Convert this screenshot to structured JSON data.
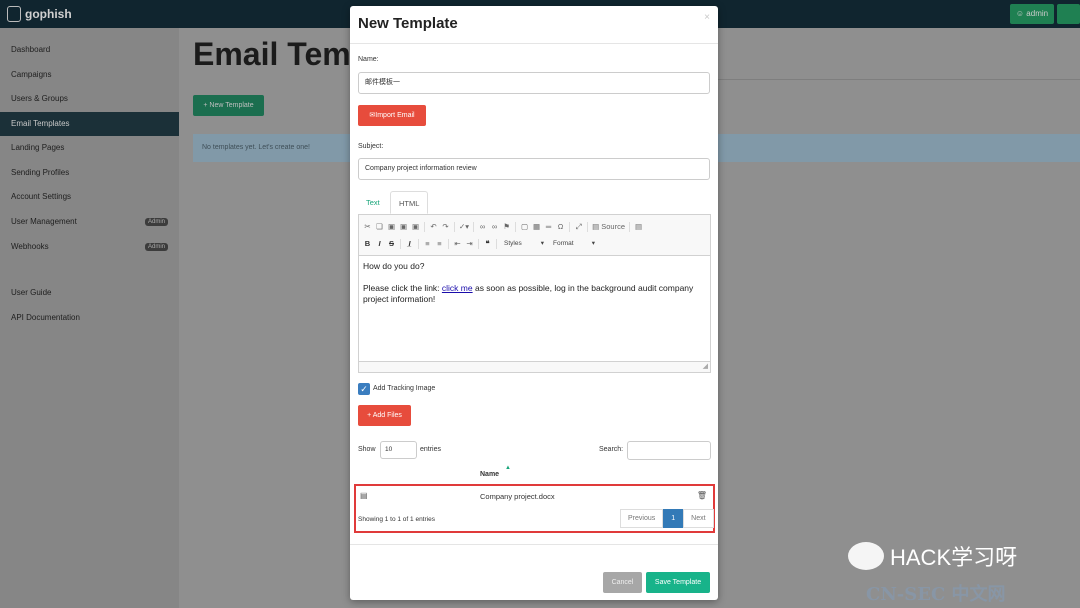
{
  "app": {
    "logo": "gophish",
    "user_button": "admin"
  },
  "sidebar": {
    "items": [
      {
        "label": "Dashboard"
      },
      {
        "label": "Campaigns"
      },
      {
        "label": "Users & Groups"
      },
      {
        "label": "Email Templates"
      },
      {
        "label": "Landing Pages"
      },
      {
        "label": "Sending Profiles"
      },
      {
        "label": "Account Settings"
      },
      {
        "label": "User Management",
        "badge": "Admin"
      },
      {
        "label": "Webhooks",
        "badge": "Admin"
      },
      {
        "label": "User Guide"
      },
      {
        "label": "API Documentation"
      }
    ]
  },
  "main": {
    "title": "Email Temp",
    "new_button": "+ New Template",
    "empty_message": "No templates yet. Let's create one!"
  },
  "modal": {
    "title": "New Template",
    "close": "×",
    "name_label": "Name:",
    "name_value": "邮件模板一",
    "import_button": "Import Email",
    "subject_label": "Subject:",
    "subject_value": "Company project information review",
    "tabs": [
      "Text",
      "HTML"
    ],
    "toolbar": {
      "source": "Source",
      "styles": "Styles",
      "format": "Format"
    },
    "editor": {
      "line1": "How do you do?",
      "line2_prefix": "Please click the link: ",
      "link_text": "click me",
      "line2_suffix": " as soon as possible, log in the background audit company project information!"
    },
    "tracking_label": "Add Tracking Image",
    "add_files_button": "+ Add Files",
    "show_label": "Show",
    "show_value": "10",
    "entries_label": "entries",
    "search_label": "Search:",
    "table": {
      "column": "Name",
      "rows": [
        {
          "name": "Company project.docx"
        }
      ]
    },
    "summary": "Showing 1 to 1 of 1 entries",
    "pagination": {
      "previous": "Previous",
      "current": "1",
      "next": "Next"
    },
    "cancel_button": "Cancel",
    "save_button": "Save Template"
  },
  "watermark": {
    "line1": "HACK学习呀",
    "line2": "CN-SEC 中文网"
  },
  "colors": {
    "accent": "#18b38a",
    "danger": "#e74c3c",
    "primary": "#337ab7"
  }
}
